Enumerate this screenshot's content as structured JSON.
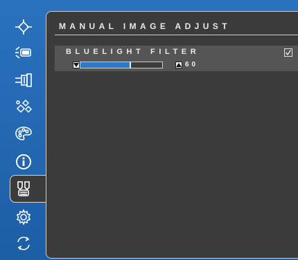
{
  "menu": {
    "title": "MANUAL IMAGE ADJUST",
    "sidebar_icons": [
      {
        "name": "input-select-icon",
        "active": false
      },
      {
        "name": "audio-adjust-icon",
        "active": false
      },
      {
        "name": "view-mode-icon",
        "active": false
      },
      {
        "name": "color-adjust-icon",
        "active": false
      },
      {
        "name": "information-icon",
        "active": false
      },
      {
        "name": "manual-image-adjust-icon",
        "active": true
      },
      {
        "name": "setup-menu-icon",
        "active": false
      },
      {
        "name": "memory-recall-icon",
        "active": false
      }
    ]
  },
  "bluelight_filter": {
    "label": "BLUELIGHT FILTER",
    "checked": true,
    "value": "60",
    "level": 0.6
  },
  "colors": {
    "background": "#1f64ad",
    "panel": "#3b3b3b",
    "selected_row": "#555555",
    "slider_fill": "#2e7ac8"
  }
}
